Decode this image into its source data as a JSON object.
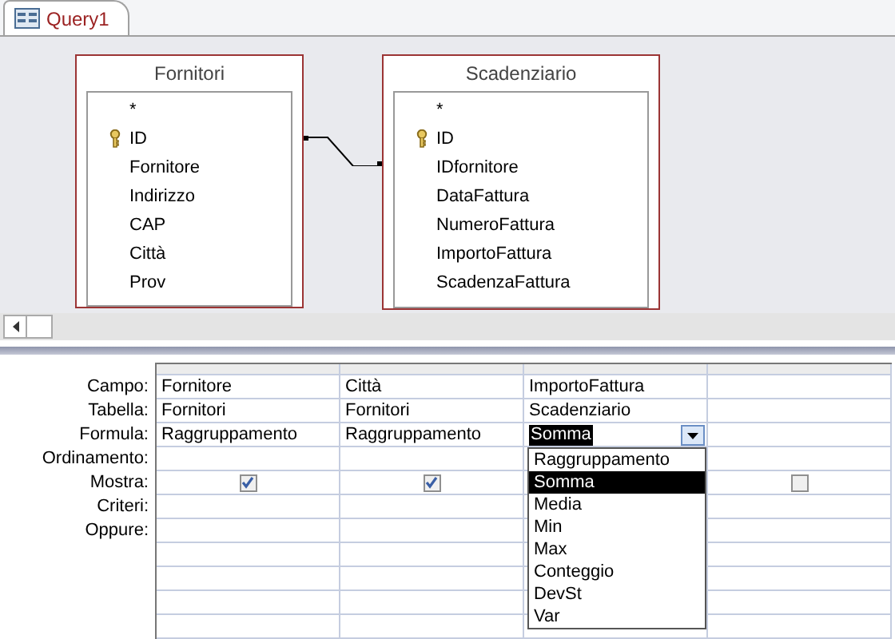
{
  "tabs": [
    {
      "label": "Query1",
      "selected": true
    }
  ],
  "tables": [
    {
      "title": "Fornitori",
      "fields": [
        {
          "name": "*",
          "key": false
        },
        {
          "name": "ID",
          "key": true
        },
        {
          "name": "Fornitore",
          "key": false
        },
        {
          "name": "Indirizzo",
          "key": false
        },
        {
          "name": "CAP",
          "key": false
        },
        {
          "name": "Città",
          "key": false
        },
        {
          "name": "Prov",
          "key": false
        }
      ]
    },
    {
      "title": "Scadenziario",
      "fields": [
        {
          "name": "*",
          "key": false
        },
        {
          "name": "ID",
          "key": true
        },
        {
          "name": "IDfornitore",
          "key": false
        },
        {
          "name": "DataFattura",
          "key": false
        },
        {
          "name": "NumeroFattura",
          "key": false
        },
        {
          "name": "ImportoFattura",
          "key": false
        },
        {
          "name": "ScadenzaFattura",
          "key": false
        }
      ]
    }
  ],
  "grid": {
    "row_labels": [
      "Campo:",
      "Tabella:",
      "Formula:",
      "Ordinamento:",
      "Mostra:",
      "Criteri:",
      "Oppure:"
    ],
    "columns": [
      {
        "campo": "Fornitore",
        "tabella": "Fornitori",
        "formula": "Raggruppamento",
        "mostra": true
      },
      {
        "campo": "Città",
        "tabella": "Fornitori",
        "formula": "Raggruppamento",
        "mostra": true
      },
      {
        "campo": "ImportoFattura",
        "tabella": "Scadenziario",
        "formula": "Somma",
        "dropdown": {
          "options": [
            {
              "label": "Raggruppamento",
              "selected": false
            },
            {
              "label": "Somma",
              "selected": true
            },
            {
              "label": "Media",
              "selected": false
            },
            {
              "label": "Min",
              "selected": false
            },
            {
              "label": "Max",
              "selected": false
            },
            {
              "label": "Conteggio",
              "selected": false
            },
            {
              "label": "DevSt",
              "selected": false
            },
            {
              "label": "Var",
              "selected": false
            }
          ]
        }
      },
      {
        "mostra": false
      }
    ]
  }
}
